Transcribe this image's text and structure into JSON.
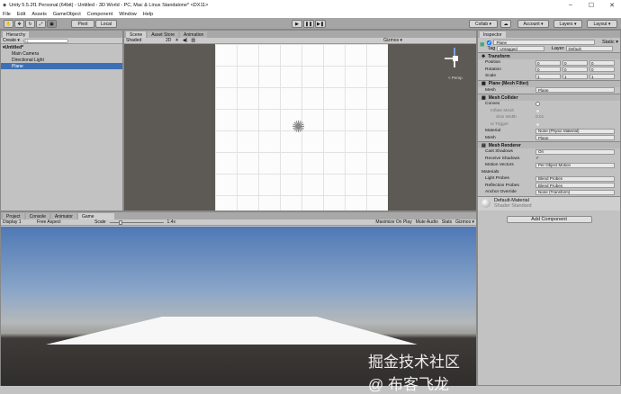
{
  "title": "Unity 5.5.2f1 Personal (64bit) - Untitled - 3D World - PC, Mac & Linux Standalone* <DX11>",
  "window_controls": {
    "minimize": "–",
    "maximize": "☐",
    "close": "✕"
  },
  "menu": [
    "File",
    "Edit",
    "Assets",
    "GameObject",
    "Component",
    "Window",
    "Help"
  ],
  "toolbar": {
    "pivot": "Pivot",
    "local": "Local",
    "collab": "Collab ▾",
    "account": "Account ▾",
    "layers": "Layers ▾",
    "layout": "Layout ▾",
    "play": "▶",
    "pause": "❚❚",
    "step": "▶❚"
  },
  "hierarchy": {
    "tab": "Hierarchy",
    "create": "Create ▾",
    "search_placeholder": "All",
    "scene": "Untitled*",
    "items": [
      "Main Camera",
      "Directional Light",
      "Plane"
    ]
  },
  "scene": {
    "tabs": [
      "Scene",
      "Asset Store",
      "Animation"
    ],
    "shading": "Shaded",
    "mode2d": "2D",
    "gizmos": "Gizmos ▾",
    "persp": "< Persp"
  },
  "bottom": {
    "tabs": [
      "Project",
      "Console",
      "Animator",
      "Game"
    ],
    "display": "Display 1",
    "aspect": "Free Aspect",
    "scale_label": "Scale",
    "scale_value": "1.4x",
    "maximize": "Maximize On Play",
    "mute": "Mute Audio",
    "stats": "Stats",
    "gizmos": "Gizmos ▾"
  },
  "inspector": {
    "tab": "Inspector",
    "name": "Plane",
    "static": "Static ▾",
    "tag_label": "Tag",
    "tag": "Untagged",
    "layer_label": "Layer",
    "layer": "Default",
    "transform": {
      "title": "Transform",
      "rows": [
        {
          "label": "Position",
          "x": "0",
          "y": "0",
          "z": "0"
        },
        {
          "label": "Rotation",
          "x": "0",
          "y": "0",
          "z": "0"
        },
        {
          "label": "Scale",
          "x": "1",
          "y": "1",
          "z": "1"
        }
      ]
    },
    "mesh_filter": {
      "title": "Plane (Mesh Filter)",
      "mesh_label": "Mesh",
      "mesh": "Plane"
    },
    "mesh_collider": {
      "title": "Mesh Collider",
      "rows": [
        {
          "label": "Convex",
          "value": ""
        },
        {
          "label": "Inflate Mesh",
          "value": ""
        },
        {
          "label": "Skin Width",
          "value": "0.01"
        },
        {
          "label": "Is Trigger",
          "value": ""
        },
        {
          "label": "Material",
          "value": "None (Physic Material)"
        },
        {
          "label": "Mesh",
          "value": "Plane"
        }
      ]
    },
    "mesh_renderer": {
      "title": "Mesh Renderer",
      "rows": [
        {
          "label": "Cast Shadows",
          "value": "On"
        },
        {
          "label": "Receive Shadows",
          "value": "✓"
        },
        {
          "label": "Motion Vectors",
          "value": "Per Object Motion"
        },
        {
          "label": "Materials",
          "value": ""
        },
        {
          "label": "Light Probes",
          "value": "Blend Probes"
        },
        {
          "label": "Reflection Probes",
          "value": "Blend Probes"
        },
        {
          "label": "Anchor Override",
          "value": "None (Transform)"
        }
      ]
    },
    "material": {
      "name": "Default-Material",
      "shader_label": "Shader",
      "shader": "Standard"
    },
    "add_component": "Add Component"
  },
  "watermark": "掘金技术社区 @ 布客飞龙"
}
